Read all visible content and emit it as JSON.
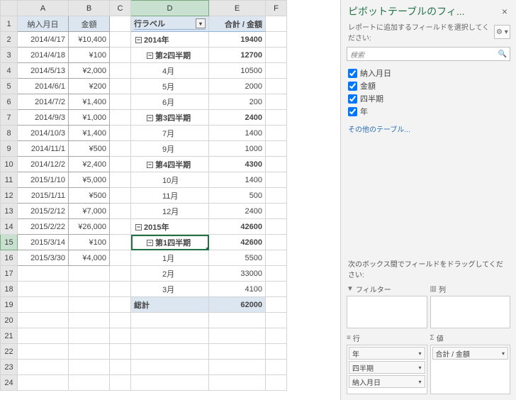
{
  "columns": [
    "A",
    "B",
    "C",
    "D",
    "E",
    "F"
  ],
  "headerA": "納入月日",
  "headerB": "金額",
  "raw": [
    {
      "r": 2,
      "d": "2014/4/17",
      "a": "¥10,400"
    },
    {
      "r": 3,
      "d": "2014/4/18",
      "a": "¥100"
    },
    {
      "r": 4,
      "d": "2014/5/13",
      "a": "¥2,000"
    },
    {
      "r": 5,
      "d": "2014/6/1",
      "a": "¥200"
    },
    {
      "r": 6,
      "d": "2014/7/2",
      "a": "¥1,400"
    },
    {
      "r": 7,
      "d": "2014/9/3",
      "a": "¥1,000"
    },
    {
      "r": 8,
      "d": "2014/10/3",
      "a": "¥1,400"
    },
    {
      "r": 9,
      "d": "2014/11/1",
      "a": "¥500"
    },
    {
      "r": 10,
      "d": "2014/12/2",
      "a": "¥2,400"
    },
    {
      "r": 11,
      "d": "2015/1/10",
      "a": "¥5,000"
    },
    {
      "r": 12,
      "d": "2015/1/11",
      "a": "¥500"
    },
    {
      "r": 13,
      "d": "2015/2/12",
      "a": "¥7,000"
    },
    {
      "r": 14,
      "d": "2015/2/22",
      "a": "¥26,000"
    },
    {
      "r": 15,
      "d": "2015/3/14",
      "a": "¥100"
    },
    {
      "r": 16,
      "d": "2015/3/30",
      "a": "¥4,000"
    }
  ],
  "pt": {
    "rowLabel": "行ラベル",
    "valLabel": "合計 / 金額",
    "total": "総計",
    "totalVal": "62000",
    "rows": [
      {
        "lvl": 1,
        "t": "2014年",
        "v": "19400",
        "b": 1,
        "tog": "-"
      },
      {
        "lvl": 2,
        "t": "第2四半期",
        "v": "12700",
        "b": 1,
        "tog": "-"
      },
      {
        "lvl": 3,
        "t": "4月",
        "v": "10500"
      },
      {
        "lvl": 3,
        "t": "5月",
        "v": "2000"
      },
      {
        "lvl": 3,
        "t": "6月",
        "v": "200"
      },
      {
        "lvl": 2,
        "t": "第3四半期",
        "v": "2400",
        "b": 1,
        "tog": "-"
      },
      {
        "lvl": 3,
        "t": "7月",
        "v": "1400"
      },
      {
        "lvl": 3,
        "t": "9月",
        "v": "1000"
      },
      {
        "lvl": 2,
        "t": "第4四半期",
        "v": "4300",
        "b": 1,
        "tog": "-"
      },
      {
        "lvl": 3,
        "t": "10月",
        "v": "1400"
      },
      {
        "lvl": 3,
        "t": "11月",
        "v": "500"
      },
      {
        "lvl": 3,
        "t": "12月",
        "v": "2400"
      },
      {
        "lvl": 1,
        "t": "2015年",
        "v": "42600",
        "b": 1,
        "tog": "-"
      },
      {
        "lvl": 2,
        "t": "第1四半期",
        "v": "42600",
        "b": 1,
        "tog": "-",
        "sel": 1
      },
      {
        "lvl": 3,
        "t": "1月",
        "v": "5500"
      },
      {
        "lvl": 3,
        "t": "2月",
        "v": "33000"
      },
      {
        "lvl": 3,
        "t": "3月",
        "v": "4100"
      }
    ]
  },
  "pane": {
    "title": "ピボットテーブルのフィ...",
    "sub": "レポートに追加するフィールドを選択してください:",
    "search": "検索",
    "fields": [
      "納入月日",
      "金額",
      "四半期",
      "年"
    ],
    "other": "その他のテーブル...",
    "dragNote": "次のボックス間でフィールドをドラッグしてください:",
    "areas": {
      "filter": "フィルター",
      "cols": "列",
      "rows": "行",
      "vals": "値",
      "rowItems": [
        "年",
        "四半期",
        "納入月日"
      ],
      "valItems": [
        "合計 / 金額"
      ]
    }
  }
}
